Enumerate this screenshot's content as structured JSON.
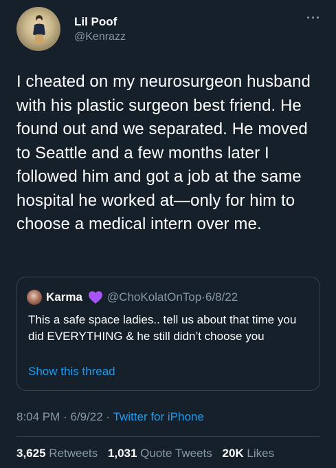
{
  "author": {
    "name": "Lil Poof",
    "handle": "@Kenrazz",
    "avatar_icon": "avatar-illustration"
  },
  "tweet": {
    "text": "I cheated on my neurosurgeon husband with his plastic surgeon best friend. He found out and we separated. He moved to Seattle and a few months later I followed him and got a job at the same hospital he worked at—only for him to choose a medical intern over me."
  },
  "quoted_tweet": {
    "name": "Karma",
    "emoji": "purple-heart-icon",
    "handle": "@ChoKolatOnTop",
    "separator": "·",
    "date": "6/8/22",
    "text": "This a safe space ladies.. tell us about that time you did EVERYTHING & he still didn’t choose you",
    "link": "Show this thread"
  },
  "meta": {
    "time": "8:04 PM",
    "sep1": "·",
    "date": "6/9/22",
    "sep2": "·",
    "source": "Twitter for iPhone"
  },
  "stats": {
    "retweets": "3,625",
    "retweets_label": "Retweets",
    "quotes": "1,031",
    "quotes_label": "Quote Tweets",
    "likes": "20K",
    "likes_label": "Likes"
  },
  "colors": {
    "background": "#15202b",
    "secondary_text": "#8899a6",
    "link": "#1d9bf0",
    "border": "#38444d",
    "heart": "#a855f7"
  }
}
